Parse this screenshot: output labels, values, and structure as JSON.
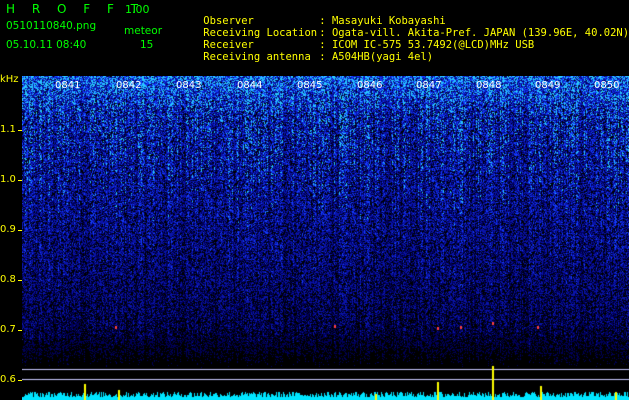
{
  "app": {
    "title": "H R O F F T",
    "version": "1.00"
  },
  "file": {
    "name": "0510110840.png",
    "datetime": "05.10.11 08:40"
  },
  "meteor": {
    "label": "meteor",
    "count": "15"
  },
  "info": [
    {
      "key": "Observer",
      "value": ": Masayuki Kobayashi"
    },
    {
      "key": "Receiving Location",
      "value": ": Ogata-vill. Akita-Pref. JAPAN (139.96E, 40.02N)"
    },
    {
      "key": "Receiver",
      "value": ": ICOM IC-575 53.7492(@LCD)MHz USB"
    },
    {
      "key": "Receiving antenna",
      "value": ": A504HB(yagi 4el)"
    }
  ],
  "y_axis": {
    "unit": "kHz",
    "ticks": [
      "1.1",
      "1.0",
      "0.9",
      "0.8",
      "0.7",
      "0.6"
    ]
  },
  "x_axis": {
    "ticks": [
      "0841",
      "0842",
      "0843",
      "0844",
      "0845",
      "0846",
      "0847",
      "0848",
      "0849",
      "0850"
    ]
  },
  "colors": {
    "label": "#ffff00",
    "title": "#00ff00",
    "background": "#000000",
    "noise": "#1a2cff",
    "baseline": "#00e5ff"
  }
}
